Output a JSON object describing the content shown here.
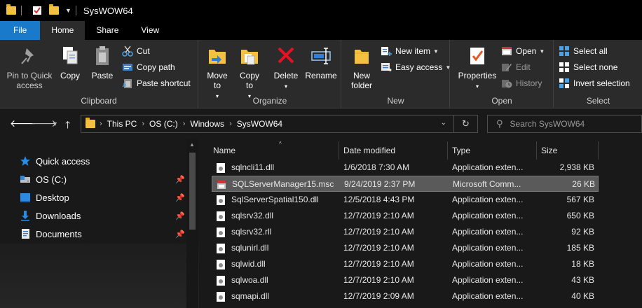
{
  "window": {
    "title": "SysWOW64"
  },
  "tabs": [
    {
      "label": "File"
    },
    {
      "label": "Home"
    },
    {
      "label": "Share"
    },
    {
      "label": "View"
    }
  ],
  "ribbon": {
    "clipboard": {
      "label": "Clipboard",
      "pin": "Pin to Quick access",
      "copy": "Copy",
      "paste": "Paste",
      "cut": "Cut",
      "copy_path": "Copy path",
      "paste_shortcut": "Paste shortcut"
    },
    "organize": {
      "label": "Organize",
      "move_to": "Move to",
      "copy_to": "Copy to",
      "delete": "Delete",
      "rename": "Rename"
    },
    "new": {
      "label": "New",
      "new_folder": "New folder",
      "new_item": "New item",
      "easy_access": "Easy access"
    },
    "open": {
      "label": "Open",
      "properties": "Properties",
      "open": "Open",
      "edit": "Edit",
      "history": "History"
    },
    "select": {
      "label": "Select",
      "select_all": "Select all",
      "select_none": "Select none",
      "invert_selection": "Invert selection"
    }
  },
  "address": {
    "crumbs": [
      "This PC",
      "OS (C:)",
      "Windows",
      "SysWOW64"
    ],
    "search_placeholder": "Search SysWOW64"
  },
  "navpane": {
    "items": [
      {
        "label": "Quick access",
        "icon": "star-icon"
      },
      {
        "label": "OS (C:)",
        "icon": "drive-icon"
      },
      {
        "label": "Desktop",
        "icon": "desktop-icon"
      },
      {
        "label": "Downloads",
        "icon": "download-icon"
      },
      {
        "label": "Documents",
        "icon": "documents-icon"
      }
    ]
  },
  "columns": {
    "name": "Name",
    "date": "Date modified",
    "type": "Type",
    "size": "Size"
  },
  "files": [
    {
      "name": "sqlncli11.dll",
      "date": "1/6/2018 7:30 AM",
      "type": "Application exten...",
      "size": "2,938 KB"
    },
    {
      "name": "SQLServerManager15.msc",
      "date": "9/24/2019 2:37 PM",
      "type": "Microsoft Comm...",
      "size": "26 KB"
    },
    {
      "name": "SqlServerSpatial150.dll",
      "date": "12/5/2018 4:43 PM",
      "type": "Application exten...",
      "size": "567 KB"
    },
    {
      "name": "sqlsrv32.dll",
      "date": "12/7/2019 2:10 AM",
      "type": "Application exten...",
      "size": "650 KB"
    },
    {
      "name": "sqlsrv32.rll",
      "date": "12/7/2019 2:10 AM",
      "type": "Application exten...",
      "size": "92 KB"
    },
    {
      "name": "sqlunirl.dll",
      "date": "12/7/2019 2:10 AM",
      "type": "Application exten...",
      "size": "185 KB"
    },
    {
      "name": "sqlwid.dll",
      "date": "12/7/2019 2:10 AM",
      "type": "Application exten...",
      "size": "18 KB"
    },
    {
      "name": "sqlwoa.dll",
      "date": "12/7/2019 2:10 AM",
      "type": "Application exten...",
      "size": "43 KB"
    },
    {
      "name": "sqmapi.dll",
      "date": "12/7/2019 2:09 AM",
      "type": "Application exten...",
      "size": "40 KB"
    }
  ],
  "colors": {
    "accent": "#1979ca",
    "selection": "#5a5a5a",
    "background": "#191919",
    "ribbon": "#2b2b2b"
  }
}
